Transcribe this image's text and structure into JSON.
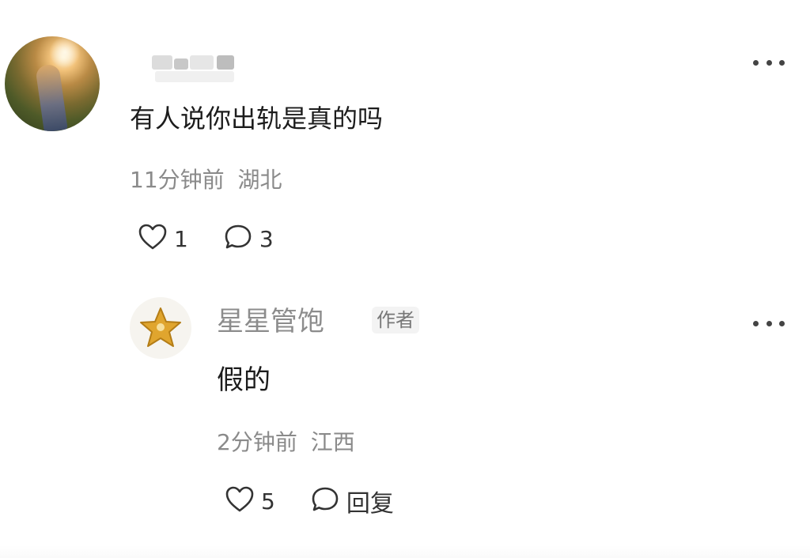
{
  "comment": {
    "avatar": "user-avatar-photo",
    "username": "",
    "text": "有人说你出轨是真的吗",
    "time": "11分钟前",
    "location": "湖北",
    "likes": "1",
    "replies": "3",
    "like_icon": "heart-outline-icon",
    "reply_icon": "chat-bubble-icon",
    "more_icon": "more-dots-icon"
  },
  "reply": {
    "avatar": "star-badge-avatar",
    "username": "星星管饱",
    "badge": "作者",
    "text": "假的",
    "time": "2分钟前",
    "location": "江西",
    "likes": "5",
    "reply_label": "回复",
    "like_icon": "heart-outline-icon",
    "reply_icon": "chat-bubble-icon",
    "more_icon": "more-dots-icon"
  },
  "colors": {
    "text_primary": "#1c1c1c",
    "text_secondary": "#8a8a8a",
    "star": "#e0a52e"
  }
}
